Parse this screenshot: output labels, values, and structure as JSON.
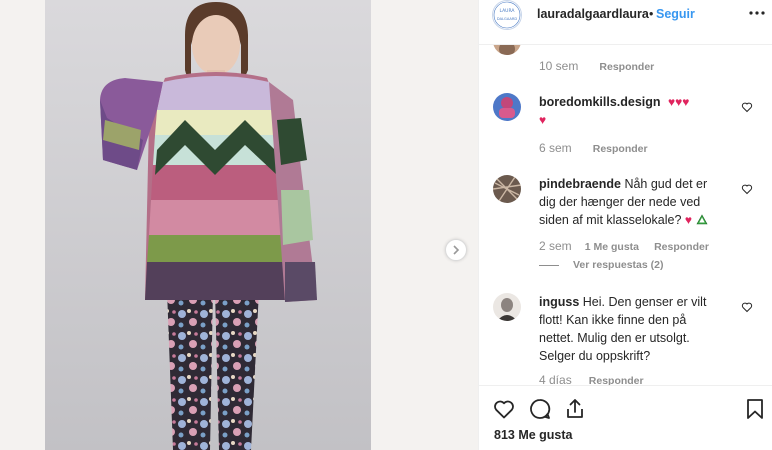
{
  "header": {
    "username": "lauradalgaardlaura",
    "separator": "•",
    "follow_label": "Seguir",
    "more_icon": "more-options-icon",
    "logo_lines": [
      "LAURA",
      "DALGAARD"
    ]
  },
  "top_comment": {
    "time": "10 sem",
    "reply_label": "Responder"
  },
  "comments": [
    {
      "username": "boredomkills.design",
      "text": "♥♥♥",
      "text_line2": "♥",
      "time": "6 sem",
      "reply_label": "Responder"
    },
    {
      "username": "pindebraende",
      "text_line1": " Nåh gud det er",
      "text_line2": "dig der hænger der nede ved",
      "text_line3": "siden af mit klasselokale?",
      "emoji": "♥",
      "time": "2 sem",
      "likes": "1 Me gusta",
      "reply_label": "Responder",
      "view_replies": "Ver respuestas (2)"
    },
    {
      "username": "inguss",
      "text_line1": " Hei. Den genser er vilt",
      "text_line2": "flott! Kan ikke finne den på",
      "text_line3": "nettet. Mulig den er utsolgt.",
      "text_line4": "Selger du oppskrift?",
      "time": "4 días",
      "reply_label": "Responder"
    }
  ],
  "actions": {
    "likes": "813 Me gusta",
    "icons": [
      "heart-icon",
      "comment-icon",
      "share-icon",
      "bookmark-icon"
    ]
  },
  "colors": {
    "link_blue": "#3897f0",
    "heart_red": "#e0245e",
    "muted": "#8e8e8e",
    "text": "#262626"
  }
}
